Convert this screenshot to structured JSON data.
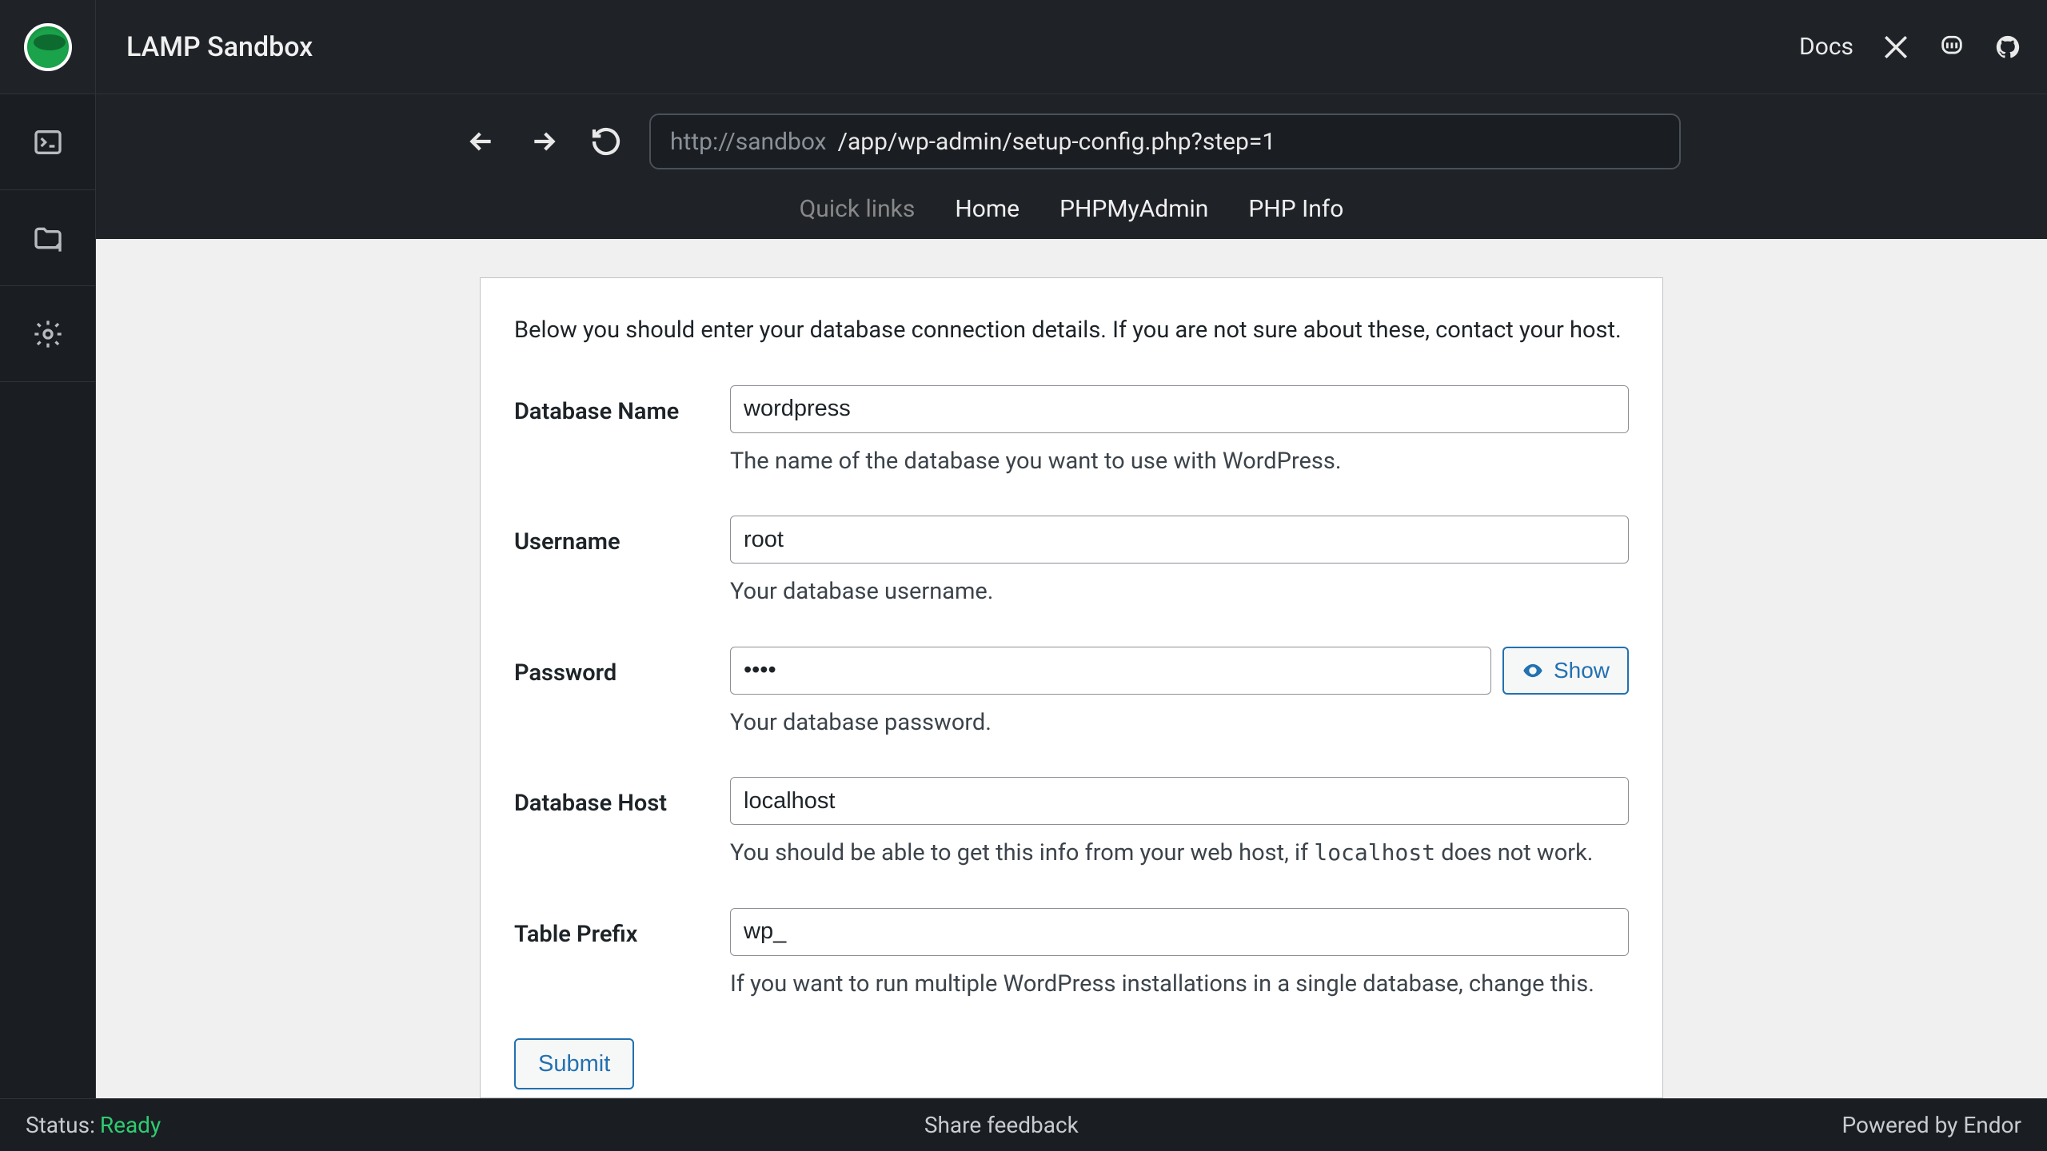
{
  "app": {
    "title": "LAMP Sandbox"
  },
  "header": {
    "docs": "Docs"
  },
  "browser": {
    "url_prefix": "http://sandbox",
    "url_path": "/app/wp-admin/setup-config.php?step=1"
  },
  "quicklinks": {
    "label": "Quick links",
    "home": "Home",
    "phpmyadmin": "PHPMyAdmin",
    "phpinfo": "PHP Info"
  },
  "wp": {
    "intro": "Below you should enter your database connection details. If you are not sure about these, contact your host.",
    "dbname": {
      "label": "Database Name",
      "value": "wordpress",
      "help": "The name of the database you want to use with WordPress."
    },
    "username": {
      "label": "Username",
      "value": "root",
      "help": "Your database username."
    },
    "password": {
      "label": "Password",
      "value": "••••",
      "help": "Your database password.",
      "show": "Show"
    },
    "dbhost": {
      "label": "Database Host",
      "value": "localhost",
      "help_pre": "You should be able to get this info from your web host, if ",
      "help_code": "localhost",
      "help_post": " does not work."
    },
    "prefix": {
      "label": "Table Prefix",
      "value": "wp_",
      "help": "If you want to run multiple WordPress installations in a single database, change this."
    },
    "submit": "Submit"
  },
  "footer": {
    "status_label": "Status:",
    "status_value": "Ready",
    "feedback": "Share feedback",
    "powered": "Powered by Endor"
  }
}
